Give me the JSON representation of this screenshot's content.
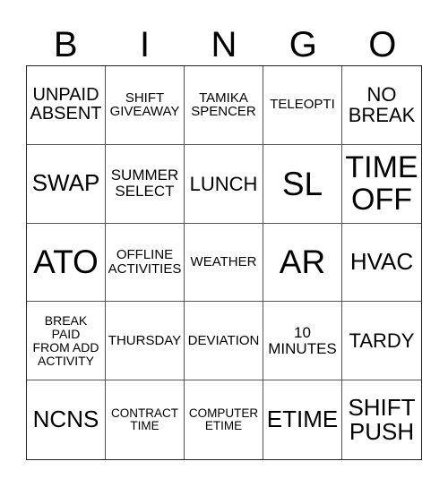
{
  "header": {
    "letters": [
      "B",
      "I",
      "N",
      "G",
      "O"
    ]
  },
  "grid": {
    "rows": [
      [
        "UNPAID ABSENT",
        "SHIFT GIVEAWAY",
        "TAMIKA SPENCER",
        "TELEOPTI",
        "NO BREAK"
      ],
      [
        "SWAP",
        "SUMMER SELECT",
        "LUNCH",
        "SL",
        "TIME OFF"
      ],
      [
        "ATO",
        "OFFLINE ACTIVITIES",
        "WEATHER",
        "AR",
        "HVAC"
      ],
      [
        "BREAK PAID FROM ADD ACTIVITY",
        "THURSDAY",
        "DEVIATION",
        "10 MINUTES",
        "TARDY"
      ],
      [
        "NCNS",
        "CONTRACT TIME",
        "COMPUTER ETIME",
        "ETIME",
        "SHIFT PUSH"
      ]
    ]
  }
}
